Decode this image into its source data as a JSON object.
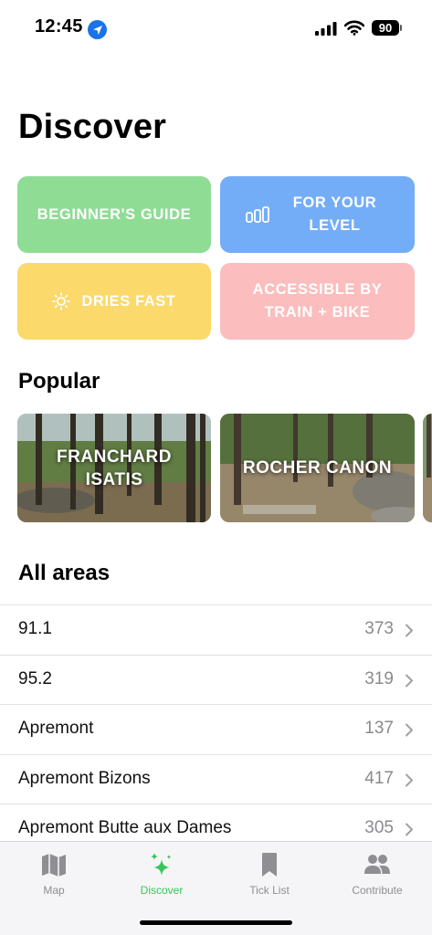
{
  "status_bar": {
    "time": "12:45",
    "battery": "90"
  },
  "page": {
    "title": "Discover"
  },
  "categories": [
    {
      "label": "BEGINNER'S GUIDE",
      "color": "#8fdc95",
      "icon": ""
    },
    {
      "label": "FOR YOUR LEVEL",
      "color": "#74adf7",
      "icon": "level-bars-icon"
    },
    {
      "label": "DRIES FAST",
      "color": "#fbd96a",
      "icon": "sun-icon"
    },
    {
      "label": "ACCESSIBLE BY TRAIN + BIKE",
      "color": "#fbbdbd",
      "icon": ""
    }
  ],
  "popular": {
    "title": "Popular",
    "items": [
      {
        "label": "FRANCHARD ISATIS"
      },
      {
        "label": "ROCHER CANON"
      }
    ]
  },
  "areas": {
    "title": "All areas",
    "items": [
      {
        "name": "91.1",
        "count": "373"
      },
      {
        "name": "95.2",
        "count": "319"
      },
      {
        "name": "Apremont",
        "count": "137"
      },
      {
        "name": "Apremont Bizons",
        "count": "417"
      },
      {
        "name": "Apremont Butte aux Dames",
        "count": "305"
      }
    ]
  },
  "tab_bar": {
    "active": "Discover",
    "active_color": "#34c759",
    "items": [
      {
        "label": "Map",
        "icon": "map-icon"
      },
      {
        "label": "Discover",
        "icon": "sparkles-icon"
      },
      {
        "label": "Tick List",
        "icon": "bookmark-icon"
      },
      {
        "label": "Contribute",
        "icon": "people-icon"
      }
    ]
  }
}
